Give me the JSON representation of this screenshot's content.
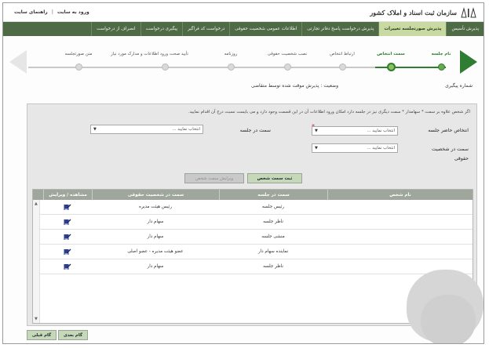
{
  "header": {
    "logo_text": "سازمان ثبت اسناد و املاک کشور",
    "login_link": "ورود به سایت",
    "help_link": "راهنمای سایت"
  },
  "menu": [
    {
      "label": "پذیرش تأسیس",
      "active": false
    },
    {
      "label": "پذیرش صورتجلسه تغییرات",
      "active": true
    },
    {
      "label": "پذیرش درخواست پاسخ دفاتر تجارتی",
      "active": false
    },
    {
      "label": "اطلاعات عمومی شخصیت حقوقی",
      "active": false
    },
    {
      "label": "درخواست کد فراگیر",
      "active": false
    },
    {
      "label": "پیگیری درخواست",
      "active": false
    },
    {
      "label": "انصراف از درخواست",
      "active": false
    }
  ],
  "stepper": {
    "steps": [
      {
        "label": "نام جلسه",
        "state": "done"
      },
      {
        "label": "سمت انتخاص",
        "state": "current"
      },
      {
        "label": "ارتباط انتخاص",
        "state": "todo"
      },
      {
        "label": "نصب شخصیت حقوقی",
        "state": "todo"
      },
      {
        "label": "روزنامه",
        "state": "todo"
      },
      {
        "label": "تأیید صحت ورود اطلاعات و مدارک مورد نیاز",
        "state": "todo"
      },
      {
        "label": "متن صورتجلسه",
        "state": "todo"
      }
    ]
  },
  "status": {
    "request_number_label": "شماره پیگیری",
    "status_text": "وضعیت : پذیرش موقت شده توسط متقاضی"
  },
  "form": {
    "hint": "اگر شخص علاوه بر سمت * سهامدار * سمت دیگری نیز در جلسه دارد امکان ورود اطلاعات آن در این قسمت وجود دارد و می بایست نسبت درج آن اقدام نمایید.",
    "person_label": "انتخاص حاضر جلسه",
    "person_placeholder": "انتخاب نمایید ...",
    "role_label": "سمت در جلسه",
    "role_placeholder": "انتخاب نمایید ...",
    "legal_role_label": "سمت در شخصیت حقوقی",
    "legal_role_placeholder": "انتخاب نمایید ...",
    "save_button": "ثبت سمت شخص",
    "edit_button": "ویرایش سمت شخص"
  },
  "table": {
    "columns": [
      "نام شخص",
      "سمت در جلسه",
      "سمت در شخصیت حقوقی",
      "مشاهده / ویرایش"
    ],
    "rows": [
      {
        "name": "",
        "meeting_role": "رئیس جلسه",
        "legal_role": "رئیس هیئت مدیره"
      },
      {
        "name": "",
        "meeting_role": "ناظر جلسه",
        "legal_role": "سهام دار"
      },
      {
        "name": "",
        "meeting_role": "منشی جلسه",
        "legal_role": "سهام دار"
      },
      {
        "name": "",
        "meeting_role": "نماینده سهام دار",
        "legal_role": "عضو هیئت مدیره - عضو اصلی"
      },
      {
        "name": "",
        "meeting_role": "ناظر جلسه",
        "legal_role": "سهام دار"
      }
    ]
  },
  "footer": {
    "prev_button": "گام قبلی",
    "next_button": "گام بعدی"
  },
  "colors": {
    "menu_bg": "#4f6b45",
    "menu_active": "#c9d9a2",
    "accent_green": "#2e7d32",
    "table_header": "#9fa79c"
  }
}
